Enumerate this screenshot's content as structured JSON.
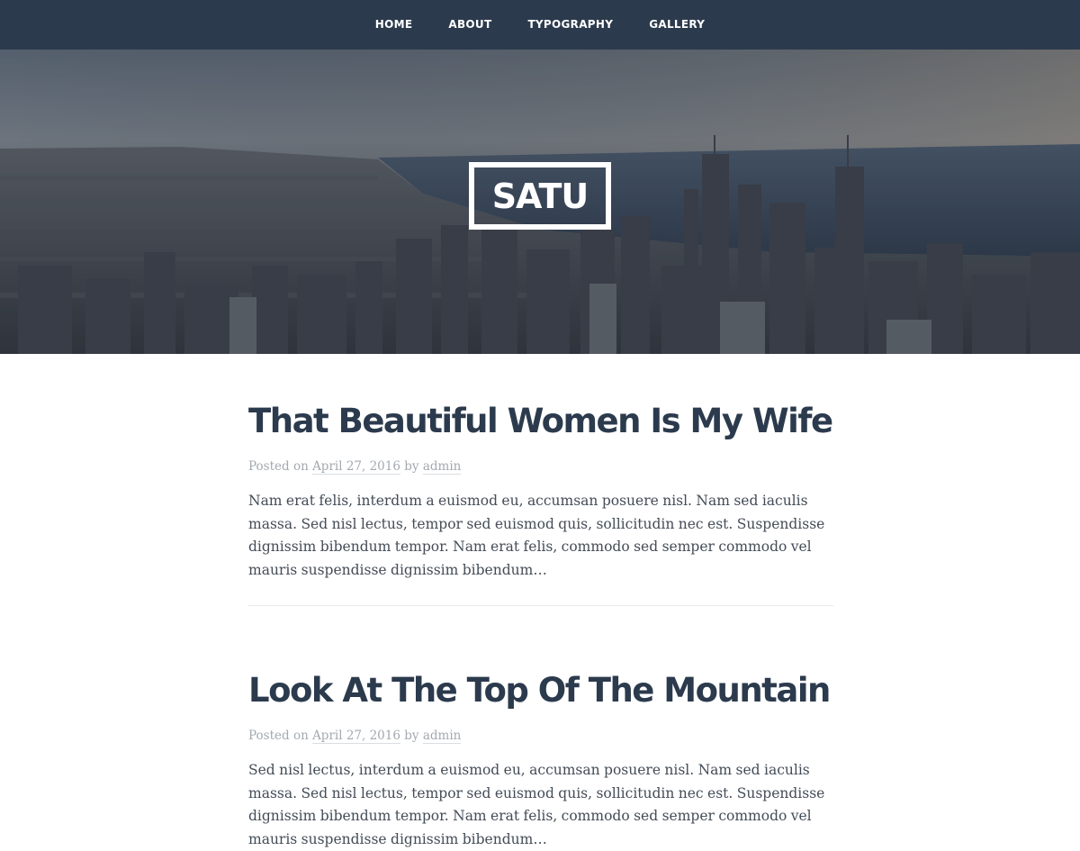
{
  "nav": {
    "items": [
      {
        "label": "HOME"
      },
      {
        "label": "ABOUT"
      },
      {
        "label": "TYPOGRAPHY"
      },
      {
        "label": "GALLERY"
      }
    ],
    "background": "#2c3a4d"
  },
  "site": {
    "title": "SATU"
  },
  "posts": [
    {
      "title": "That Beautiful Women Is My Wife",
      "posted_on_label": "Posted on",
      "date": "April 27, 2016",
      "by_label": "by",
      "author": "admin",
      "excerpt": "Nam erat felis, interdum a euismod eu, accumsan posuere nisl. Nam sed iaculis massa. Sed nisl lectus, tempor sed euismod quis, sollicitudin nec est. Suspendisse dignissim bibendum tempor. Nam erat felis, commodo sed semper commodo vel mauris suspendisse dignissim bibendum…"
    },
    {
      "title": "Look At The Top Of The Mountain",
      "posted_on_label": "Posted on",
      "date": "April 27, 2016",
      "by_label": "by",
      "author": "admin",
      "excerpt": "Sed nisl lectus, interdum a euismod eu, accumsan posuere nisl. Nam sed iaculis massa. Sed nisl lectus, tempor sed euismod quis, sollicitudin nec est. Suspendisse dignissim bibendum tempor. Nam erat felis, commodo sed semper commodo vel mauris suspendisse dignissim bibendum…"
    }
  ],
  "colors": {
    "title": "#2c3a4d",
    "meta": "#a3a9b0",
    "text": "#434c57"
  }
}
